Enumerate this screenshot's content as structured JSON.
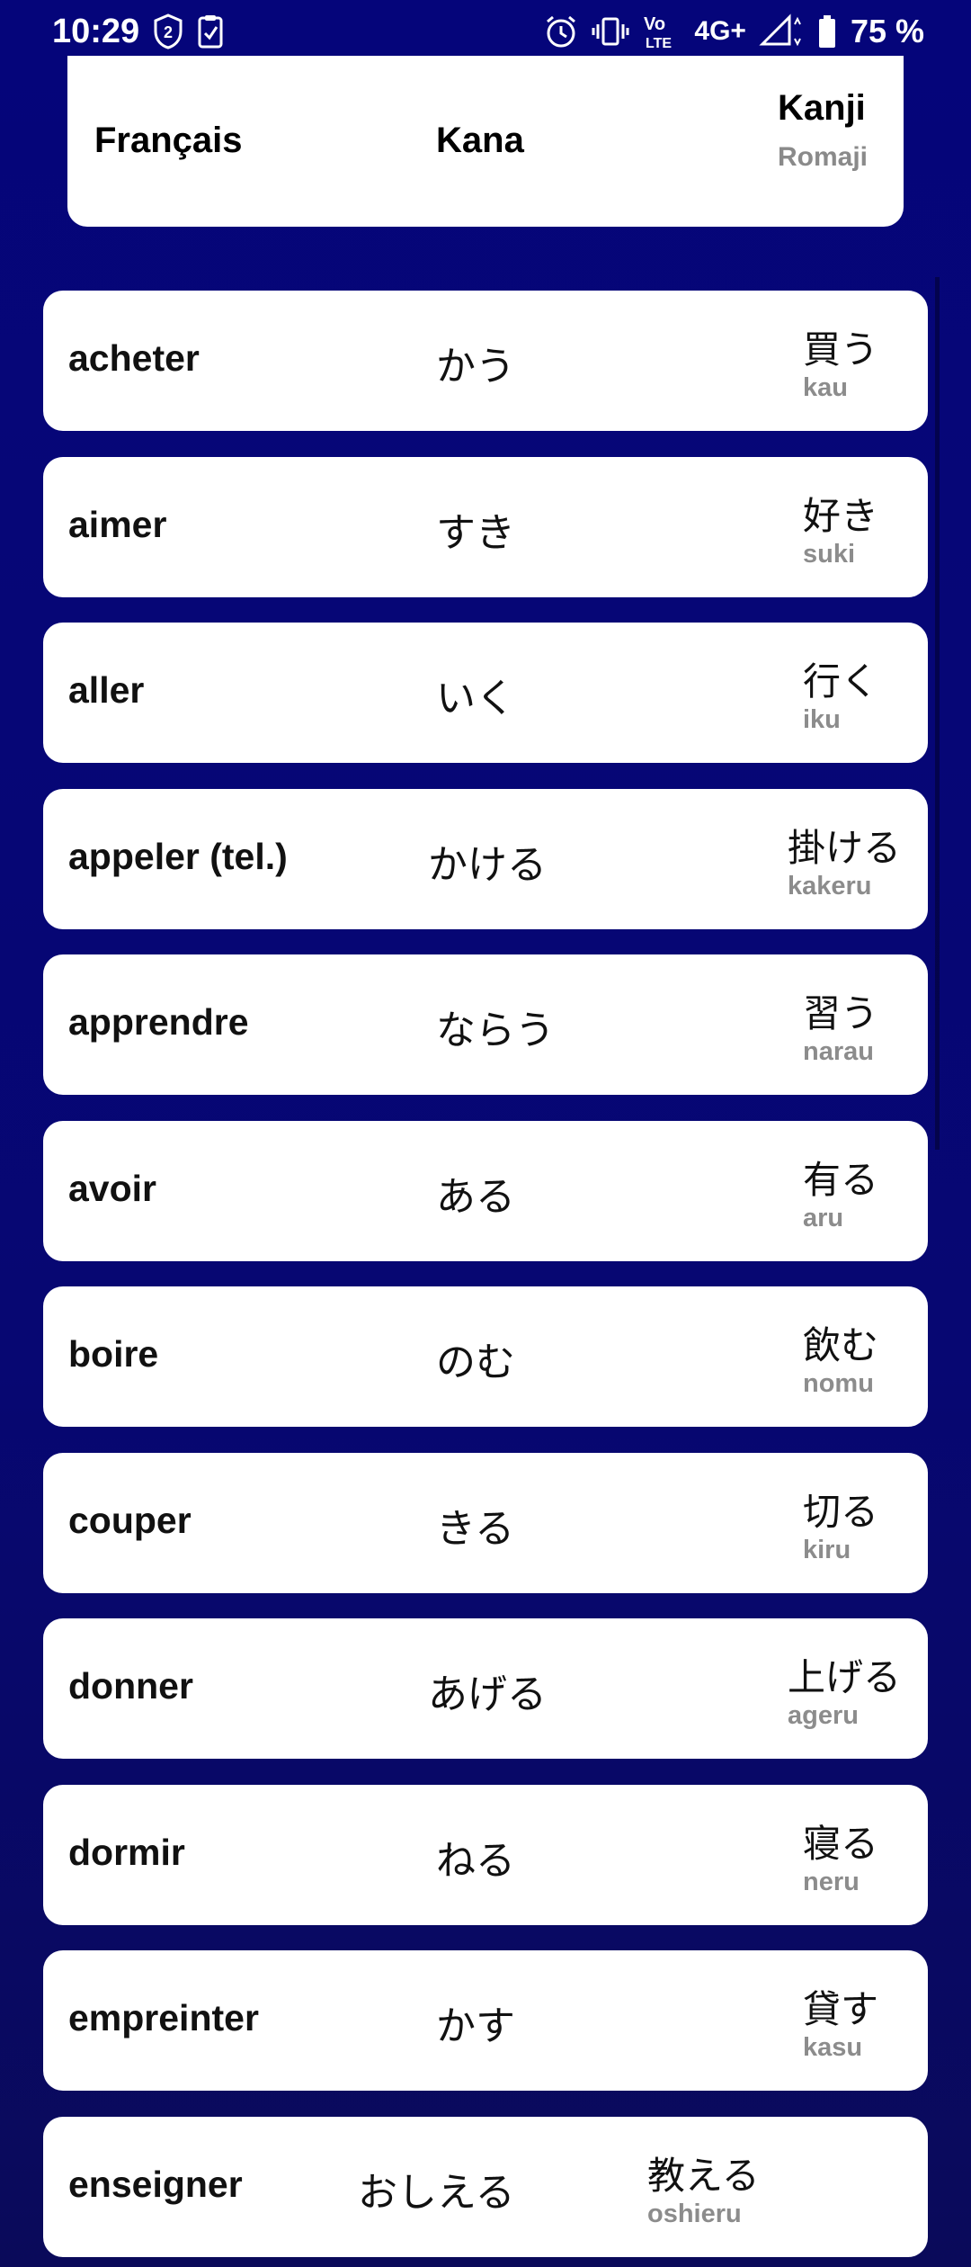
{
  "status_bar": {
    "time": "10:29",
    "battery": "75 %",
    "network": "4G+",
    "icons": [
      "notification-badge-2-icon",
      "clipboard-check-icon",
      "alarm-icon",
      "vibrate-icon",
      "volte-icon",
      "signal-icon",
      "battery-icon"
    ],
    "badge_count": "2",
    "volte_label": "Vo",
    "lte_label": "LTE"
  },
  "header": {
    "francais": "Français",
    "kana": "Kana",
    "kanji": "Kanji",
    "romaji": "Romaji"
  },
  "words": [
    {
      "fr": "acheter",
      "kana": "かう",
      "kanji": "買う",
      "romaji": "kau"
    },
    {
      "fr": "aimer",
      "kana": "すき",
      "kanji": "好き",
      "romaji": "suki"
    },
    {
      "fr": "aller",
      "kana": "いく",
      "kanji": "行く",
      "romaji": "iku"
    },
    {
      "fr": "appeler (tel.)",
      "kana": "かける",
      "kanji": "掛ける",
      "romaji": "kakeru"
    },
    {
      "fr": "apprendre",
      "kana": "ならう",
      "kanji": "習う",
      "romaji": "narau"
    },
    {
      "fr": "avoir",
      "kana": "ある",
      "kanji": "有る",
      "romaji": "aru"
    },
    {
      "fr": "boire",
      "kana": "のむ",
      "kanji": "飲む",
      "romaji": "nomu"
    },
    {
      "fr": "couper",
      "kana": "きる",
      "kanji": "切る",
      "romaji": "kiru"
    },
    {
      "fr": "donner",
      "kana": "あげる",
      "kanji": "上げる",
      "romaji": "ageru"
    },
    {
      "fr": "dormir",
      "kana": "ねる",
      "kanji": "寝る",
      "romaji": "neru"
    },
    {
      "fr": "empreinter",
      "kana": "かす",
      "kanji": "貸す",
      "romaji": "kasu"
    },
    {
      "fr": "enseigner",
      "kana": "おしえる",
      "kanji": "教える",
      "romaji": "oshieru"
    }
  ],
  "colors": {
    "background": "#06067a",
    "card": "#ffffff",
    "romaji_text": "#8c8c8c"
  }
}
